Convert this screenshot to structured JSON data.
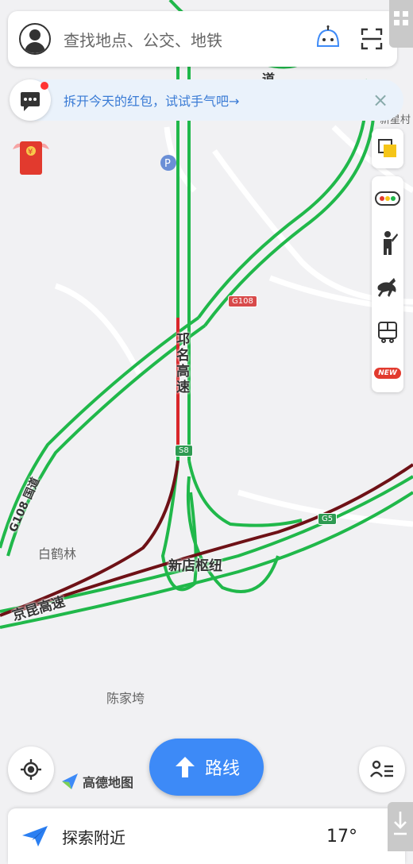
{
  "search": {
    "placeholder": "查找地点、公交、地铁"
  },
  "banner": {
    "text": "拆开今天的红包，试试手气吧→",
    "close": "×"
  },
  "map": {
    "labels": {
      "bai_he_lin": "白鹤林",
      "chen_jia_wan": "陈家垮",
      "xin_dian_shu_niu": "新店枢纽",
      "qiong_ming_gao_su": "邛名高速",
      "jing_kun_gao_su": "京昆高速",
      "g108_road": "G108 国道",
      "partial_top": "道",
      "partial_right": "新星村"
    },
    "shields": {
      "g108": "G108",
      "s8": "S8",
      "g5": "G5"
    }
  },
  "rightbar": {
    "new_badge": "NEW"
  },
  "route_button": {
    "label": "路线"
  },
  "logo": {
    "text": "高德地图"
  },
  "bottom": {
    "explore": "探索附近",
    "temperature": "17°"
  },
  "colors": {
    "road_green": "#20b84a",
    "road_red": "#d9262a",
    "road_darkred": "#6e1116",
    "accent": "#3d8af7"
  }
}
